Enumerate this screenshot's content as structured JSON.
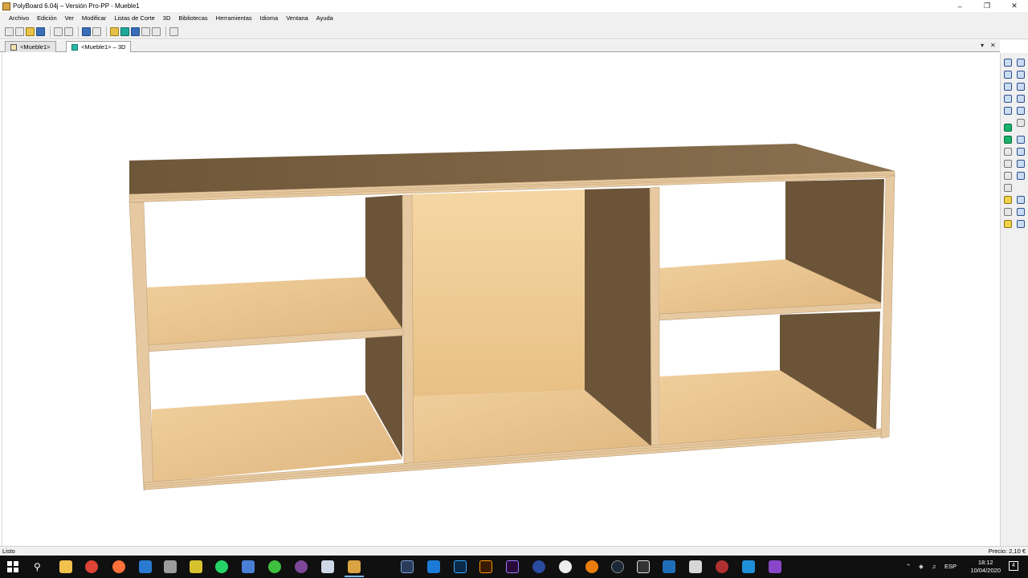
{
  "window": {
    "title": "PolyBoard 6.04j – Versión Pro-PP - Mueble1",
    "minimize_icon": "–",
    "restore_icon": "❐",
    "close_icon": "✕"
  },
  "menu": [
    "Archivo",
    "Edición",
    "Ver",
    "Modificar",
    "Listas de Corte",
    "3D",
    "Bibliotecas",
    "Herramientas",
    "Idioma",
    "Ventana",
    "Ayuda"
  ],
  "tabs": [
    {
      "label": "<Mueble1>",
      "icon": "sheet-icon",
      "active": false
    },
    {
      "label": "<Mueble1> – 3D",
      "icon": "3d-view-icon",
      "active": true
    }
  ],
  "tab_controls": {
    "dropdown": "▾",
    "close": "✕"
  },
  "status": {
    "left": "Listo",
    "right": "Precio: 2,10 €"
  },
  "taskbar": {
    "time": "18:12",
    "date": "10/04/2020",
    "language": "ESP",
    "notifications": "4",
    "apps": [
      "file-explorer",
      "chrome",
      "firefox",
      "edge",
      "gcompris",
      "whatsapp",
      "editor",
      "utorrent",
      "tor",
      "app",
      "polyboard",
      "lightroom",
      "sketchup",
      "photoshop",
      "illustrator",
      "premiere",
      "cinema4d",
      "unreal",
      "blender",
      "steam",
      "sketchbook",
      "deadline",
      "airplane",
      "blueshift",
      "cycle",
      "visualstudio"
    ]
  },
  "colors": {
    "wood_light": "#e8c48f",
    "wood_dark": "#6b5438",
    "top_surface": "#7d6647",
    "edge_ply": "#e6c9a0"
  }
}
